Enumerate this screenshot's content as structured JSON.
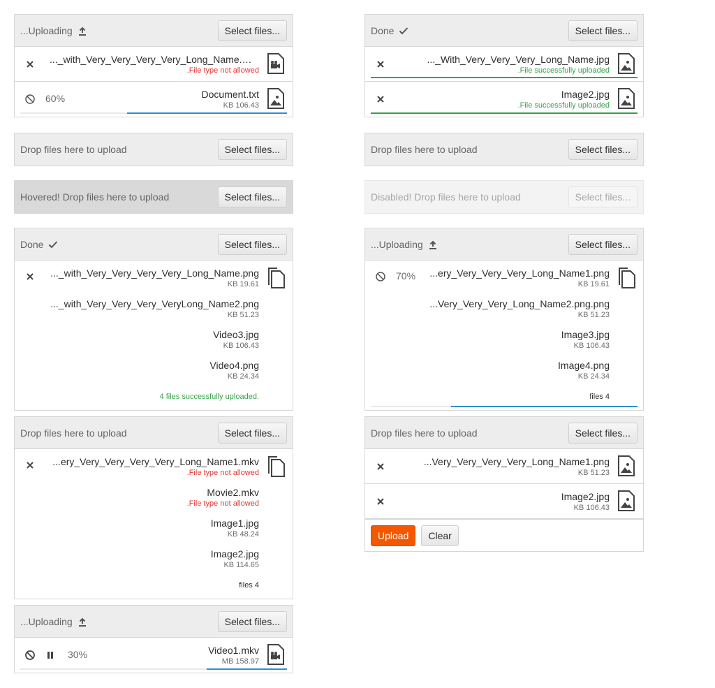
{
  "select_label": "Select files...",
  "u1": {
    "status": "...Uploading",
    "files": [
      {
        "name": "..._with_Very_Very_Very_Very_Long_Name.mkv",
        "meta": ".File type not allowed"
      },
      {
        "name": "Document.txt",
        "meta": "KB 106.43",
        "percent": "60%",
        "progress": 0.6
      }
    ]
  },
  "u2": {
    "status": "Done",
    "files": [
      {
        "name": "..._With_Very_Very_Very_Long_Name.jpg",
        "meta": ".File successfully uploaded"
      },
      {
        "name": "Image2.jpg",
        "meta": ".File successfully uploaded"
      }
    ]
  },
  "u3": {
    "status": "Drop files here to upload"
  },
  "u4": {
    "status": "Drop files here to upload"
  },
  "u5": {
    "status": "Hovered! Drop files here to upload"
  },
  "u6": {
    "status": "Disabled! Drop files here to upload"
  },
  "u7": {
    "status": "Done",
    "files": [
      {
        "name": "..._with_Very_Very_Very_Very_Long_Name.png",
        "meta": "KB 19.61"
      },
      {
        "name": "..._with_Very_Very_Very_VeryLong_Name2.png",
        "meta": "KB 51.23"
      },
      {
        "name": "Video3.jpg",
        "meta": "KB 106.43"
      },
      {
        "name": "Video4.png",
        "meta": "KB 24.34"
      }
    ],
    "summary": "4 files successfully uploaded."
  },
  "u8": {
    "status": "...Uploading",
    "percent": "70%",
    "progress": 0.7,
    "files": [
      {
        "name": "...ery_Very_Very_Very_Long_Name1.png",
        "meta": "KB 19.61"
      },
      {
        "name": "...Very_Very_Very_Long_Name2.png.png",
        "meta": "KB 51.23"
      },
      {
        "name": "Image3.jpg",
        "meta": "KB 106.43"
      },
      {
        "name": "Image4.png",
        "meta": "KB 24.34"
      }
    ],
    "summary": "files 4"
  },
  "u9": {
    "status": "Drop files here to upload",
    "files": [
      {
        "name": "...ery_Very_Very_Very_Very_Long_Name1.mkv",
        "meta": ".File type not allowed"
      },
      {
        "name": "Movie2.mkv",
        "meta": ".File type not allowed"
      },
      {
        "name": "Image1.jpg",
        "meta": "KB 48.24"
      },
      {
        "name": "Image2.jpg",
        "meta": "KB 114.65"
      }
    ],
    "summary": "files 4"
  },
  "u10": {
    "status": "Drop files here to upload",
    "files": [
      {
        "name": "...Very_Very_Very_Very_Long_Name1.png",
        "meta": "KB 51.23"
      },
      {
        "name": "Image2.jpg",
        "meta": "KB 106.43"
      }
    ],
    "upload_label": "Upload",
    "clear_label": "Clear"
  },
  "u11": {
    "status": "...Uploading",
    "files": [
      {
        "name": "Video1.mkv",
        "meta": "MB 158.97",
        "percent": "30%",
        "progress": 0.3
      }
    ]
  },
  "colors": {
    "accent": "#f35800",
    "progress": "#2e8ecf",
    "success": "#37a24a",
    "error": "#e53935"
  }
}
